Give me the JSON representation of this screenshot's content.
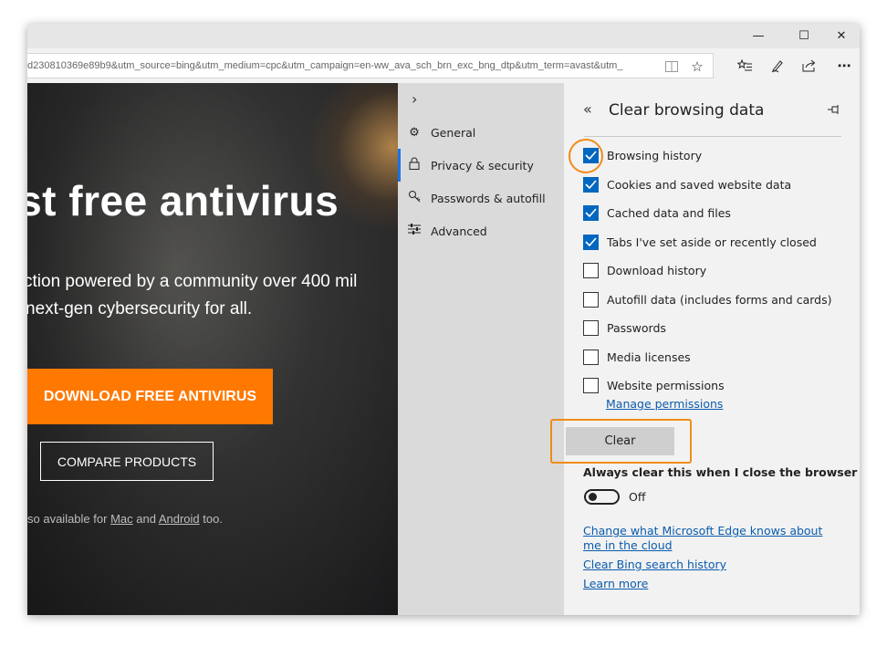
{
  "window": {
    "minimize": "—",
    "maximize": "☐",
    "close": "✕"
  },
  "address_bar": {
    "url": "d230810369e89b9&utm_source=bing&utm_medium=cpc&utm_campaign=en-ww_ava_sch_brn_exc_bng_dtp&utm_term=avast&utm_"
  },
  "hero": {
    "title": "est free antivirus",
    "subtitle_line1": "ction powered by a community over 400 mil",
    "subtitle_line2": " next-gen cybersecurity for all.",
    "download_label": "DOWNLOAD FREE ANTIVIRUS",
    "compare_label": "COMPARE PRODUCTS",
    "available_prefix": "so available for ",
    "available_mac": "Mac",
    "available_and": " and ",
    "available_android": "Android",
    "available_suffix": " too."
  },
  "settings_menu": {
    "items": [
      {
        "label": "General",
        "icon": "gear-icon"
      },
      {
        "label": "Privacy & security",
        "icon": "lock-icon"
      },
      {
        "label": "Passwords & autofill",
        "icon": "key-icon"
      },
      {
        "label": "Advanced",
        "icon": "sliders-icon"
      }
    ],
    "selected": "Privacy & security"
  },
  "clear_panel": {
    "title": "Clear browsing data",
    "options": [
      {
        "label": "Browsing history",
        "checked": true
      },
      {
        "label": "Cookies and saved website data",
        "checked": true
      },
      {
        "label": "Cached data and files",
        "checked": true
      },
      {
        "label": "Tabs I've set aside or recently closed",
        "checked": true
      },
      {
        "label": "Download history",
        "checked": false
      },
      {
        "label": "Autofill data (includes forms and cards)",
        "checked": false
      },
      {
        "label": "Passwords",
        "checked": false
      },
      {
        "label": "Media licenses",
        "checked": false
      },
      {
        "label": "Website permissions",
        "checked": false
      }
    ],
    "manage_permissions": "Manage permissions",
    "clear_button": "Clear",
    "always_clear": "Always clear this when I close the browser",
    "toggle_state": "Off",
    "links": [
      "Change what Microsoft Edge knows about me in the cloud",
      "Clear Bing search history",
      "Learn more"
    ]
  },
  "colors": {
    "accent": "#0067c0",
    "highlight": "#f08c1a",
    "download_button": "#ff7800"
  }
}
